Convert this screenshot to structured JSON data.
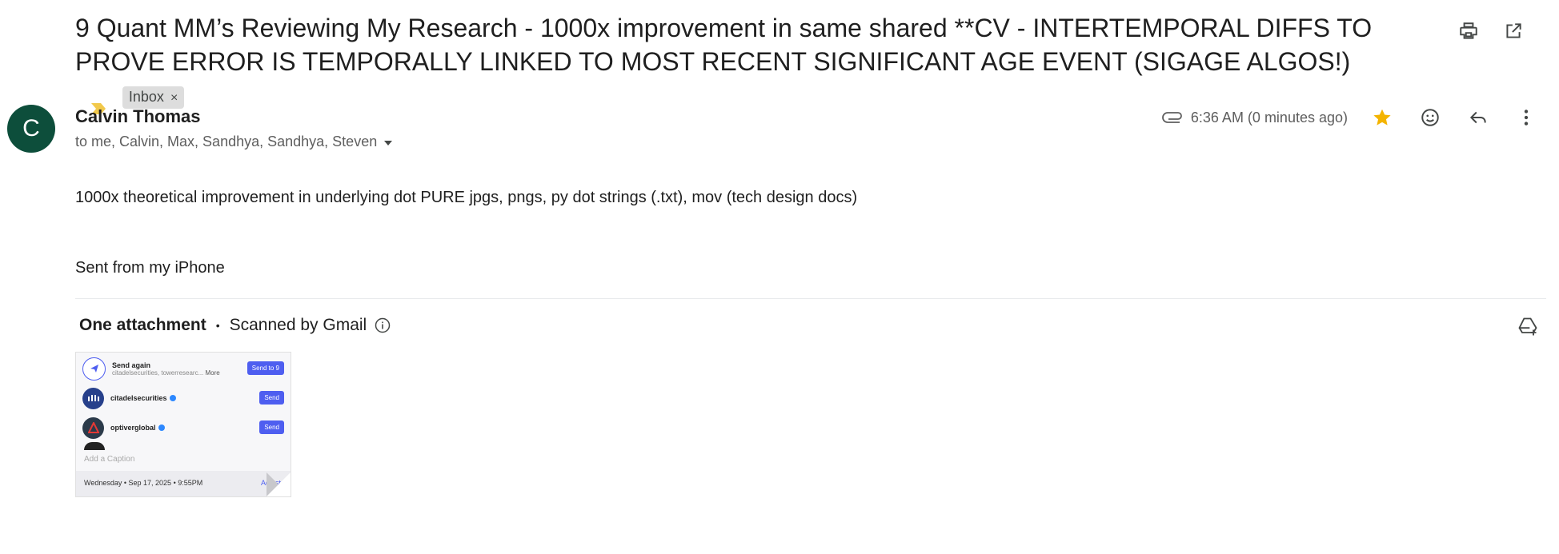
{
  "email": {
    "subject": "9 Quant MM’s Reviewing My Research - 1000x improvement in same shared **CV - INTERTEMPORAL DIFFS TO PROVE ERROR IS TEMPORALLY LINKED TO MOST RECENT SIGNIFICANT AGE EVENT (SIGAGE ALGOS!)",
    "label": "Inbox",
    "label_close": "×",
    "avatar_letter": "C",
    "sender": "Calvin Thomas",
    "recipients": "to me, Calvin, Max, Sandhya, Sandhya, Steven",
    "time": "6:36 AM (0 minutes ago)",
    "body_line1": "1000x theoretical improvement in underlying dot PURE jpgs, pngs, py dot strings (.txt), mov (tech design docs)",
    "body_line2": "Sent from my iPhone"
  },
  "attachments": {
    "heading": "One attachment",
    "separator": "•",
    "scanned": "Scanned by Gmail"
  },
  "thumbnail": {
    "row1_title": "Send again",
    "row1_sub": "citadelsecurities, towerresearc...",
    "row1_more": "More",
    "row1_button": "Send to 9",
    "row2_title": "citadelsecurities",
    "row2_button": "Send",
    "row3_title": "optiverglobal",
    "row3_button": "Send",
    "caption": "Add a Caption",
    "date": "Wednesday • Sep 17, 2025 • 9:55PM",
    "adjust": "Adjust"
  },
  "colors": {
    "avatar": "#0d4e3b",
    "star": "#f4b400",
    "importance": "#f2c94c",
    "send_button": "#4e5ef0"
  },
  "icons": [
    "print-icon",
    "open-in-new-window-icon",
    "importance-marker-icon",
    "chevron-down-icon",
    "attachment-clip-icon",
    "star-icon",
    "emoji-icon",
    "reply-icon",
    "more-vert-icon",
    "info-icon",
    "add-to-drive-icon"
  ]
}
